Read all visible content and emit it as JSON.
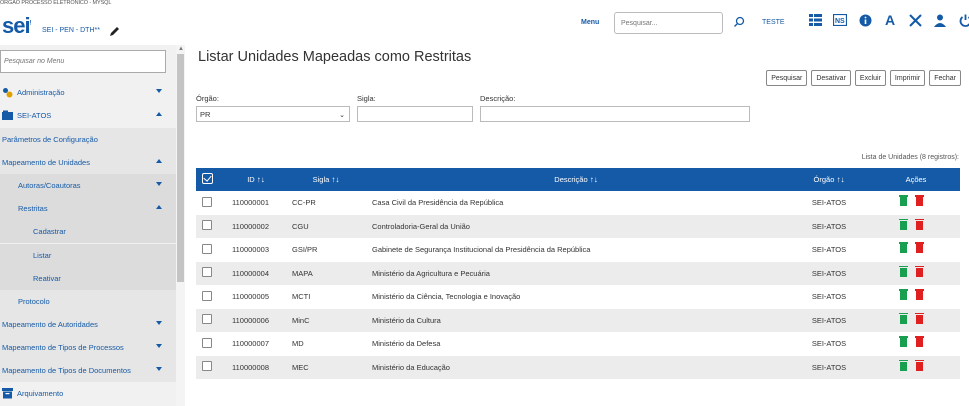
{
  "header": {
    "org_line": "ÓRGÃO PROCESSO ELETRÔNICO - MYSQL",
    "logo": "sei",
    "org_units": "SEI - PEN - DTH**",
    "menu_label": "Menu",
    "search_placeholder": "Pesquisar...",
    "user": "TESTE",
    "icons": [
      "grid-icon",
      "ns-icon",
      "info-icon",
      "font-icon",
      "tools-icon",
      "user-icon",
      "power-icon"
    ]
  },
  "sidebar": {
    "search_placeholder": "Pesquisar no Menu",
    "items": [
      {
        "label": "Administração",
        "icon": "gears-icon",
        "arrow": "down"
      },
      {
        "label": "SEI-ATOS",
        "icon": "folder-icon",
        "arrow": "up"
      },
      {
        "label": "Parâmetros de Configuração"
      },
      {
        "label": "Mapeamento de Unidades",
        "arrow": "up"
      },
      {
        "label": "Autoras/Coautoras",
        "arrow": "down"
      },
      {
        "label": "Restritas",
        "arrow": "up"
      },
      {
        "label": "Cadastrar"
      },
      {
        "label": "Listar"
      },
      {
        "label": "Reativar"
      },
      {
        "label": "Protocolo"
      },
      {
        "label": "Mapeamento de Autoridades",
        "arrow": "down"
      },
      {
        "label": "Mapeamento de Tipos de Processos",
        "arrow": "down"
      },
      {
        "label": "Mapeamento de Tipos de Documentos",
        "arrow": "down"
      },
      {
        "label": "Arquivamento",
        "icon": "archive-icon"
      }
    ]
  },
  "main": {
    "title": "Listar Unidades Mapeadas como Restritas",
    "buttons": [
      "Pesquisar",
      "Desativar",
      "Excluir",
      "Imprimir",
      "Fechar"
    ],
    "filters": {
      "orgao_label": "Órgão:",
      "orgao_value": "PR",
      "sigla_label": "Sigla:",
      "sigla_value": "",
      "descricao_label": "Descrição:",
      "descricao_value": ""
    },
    "caption": "Lista de Unidades (8 registros):",
    "columns": [
      "ID",
      "Sigla",
      "Descrição",
      "Órgão",
      "Ações"
    ],
    "rows": [
      {
        "id": "110000001",
        "sigla": "CC-PR",
        "descricao": "Casa Civil da Presidência da República",
        "orgao": "SEI-ATOS"
      },
      {
        "id": "110000002",
        "sigla": "CGU",
        "descricao": "Controladoria-Geral da União",
        "orgao": "SEI-ATOS"
      },
      {
        "id": "110000003",
        "sigla": "GSI/PR",
        "descricao": "Gabinete de Segurança Institucional da Presidência da República",
        "orgao": "SEI-ATOS"
      },
      {
        "id": "110000004",
        "sigla": "MAPA",
        "descricao": "Ministério da Agricultura e Pecuária",
        "orgao": "SEI-ATOS"
      },
      {
        "id": "110000005",
        "sigla": "MCTI",
        "descricao": "Ministério da Ciência, Tecnologia e Inovação",
        "orgao": "SEI-ATOS"
      },
      {
        "id": "110000006",
        "sigla": "MinC",
        "descricao": "Ministério da Cultura",
        "orgao": "SEI-ATOS"
      },
      {
        "id": "110000007",
        "sigla": "MD",
        "descricao": "Ministério da Defesa",
        "orgao": "SEI-ATOS"
      },
      {
        "id": "110000008",
        "sigla": "MEC",
        "descricao": "Ministério da Educação",
        "orgao": "SEI-ATOS"
      }
    ],
    "colors": {
      "header_bg": "#155aa7",
      "reactivate": "#18a050",
      "delete": "#e02020"
    }
  }
}
